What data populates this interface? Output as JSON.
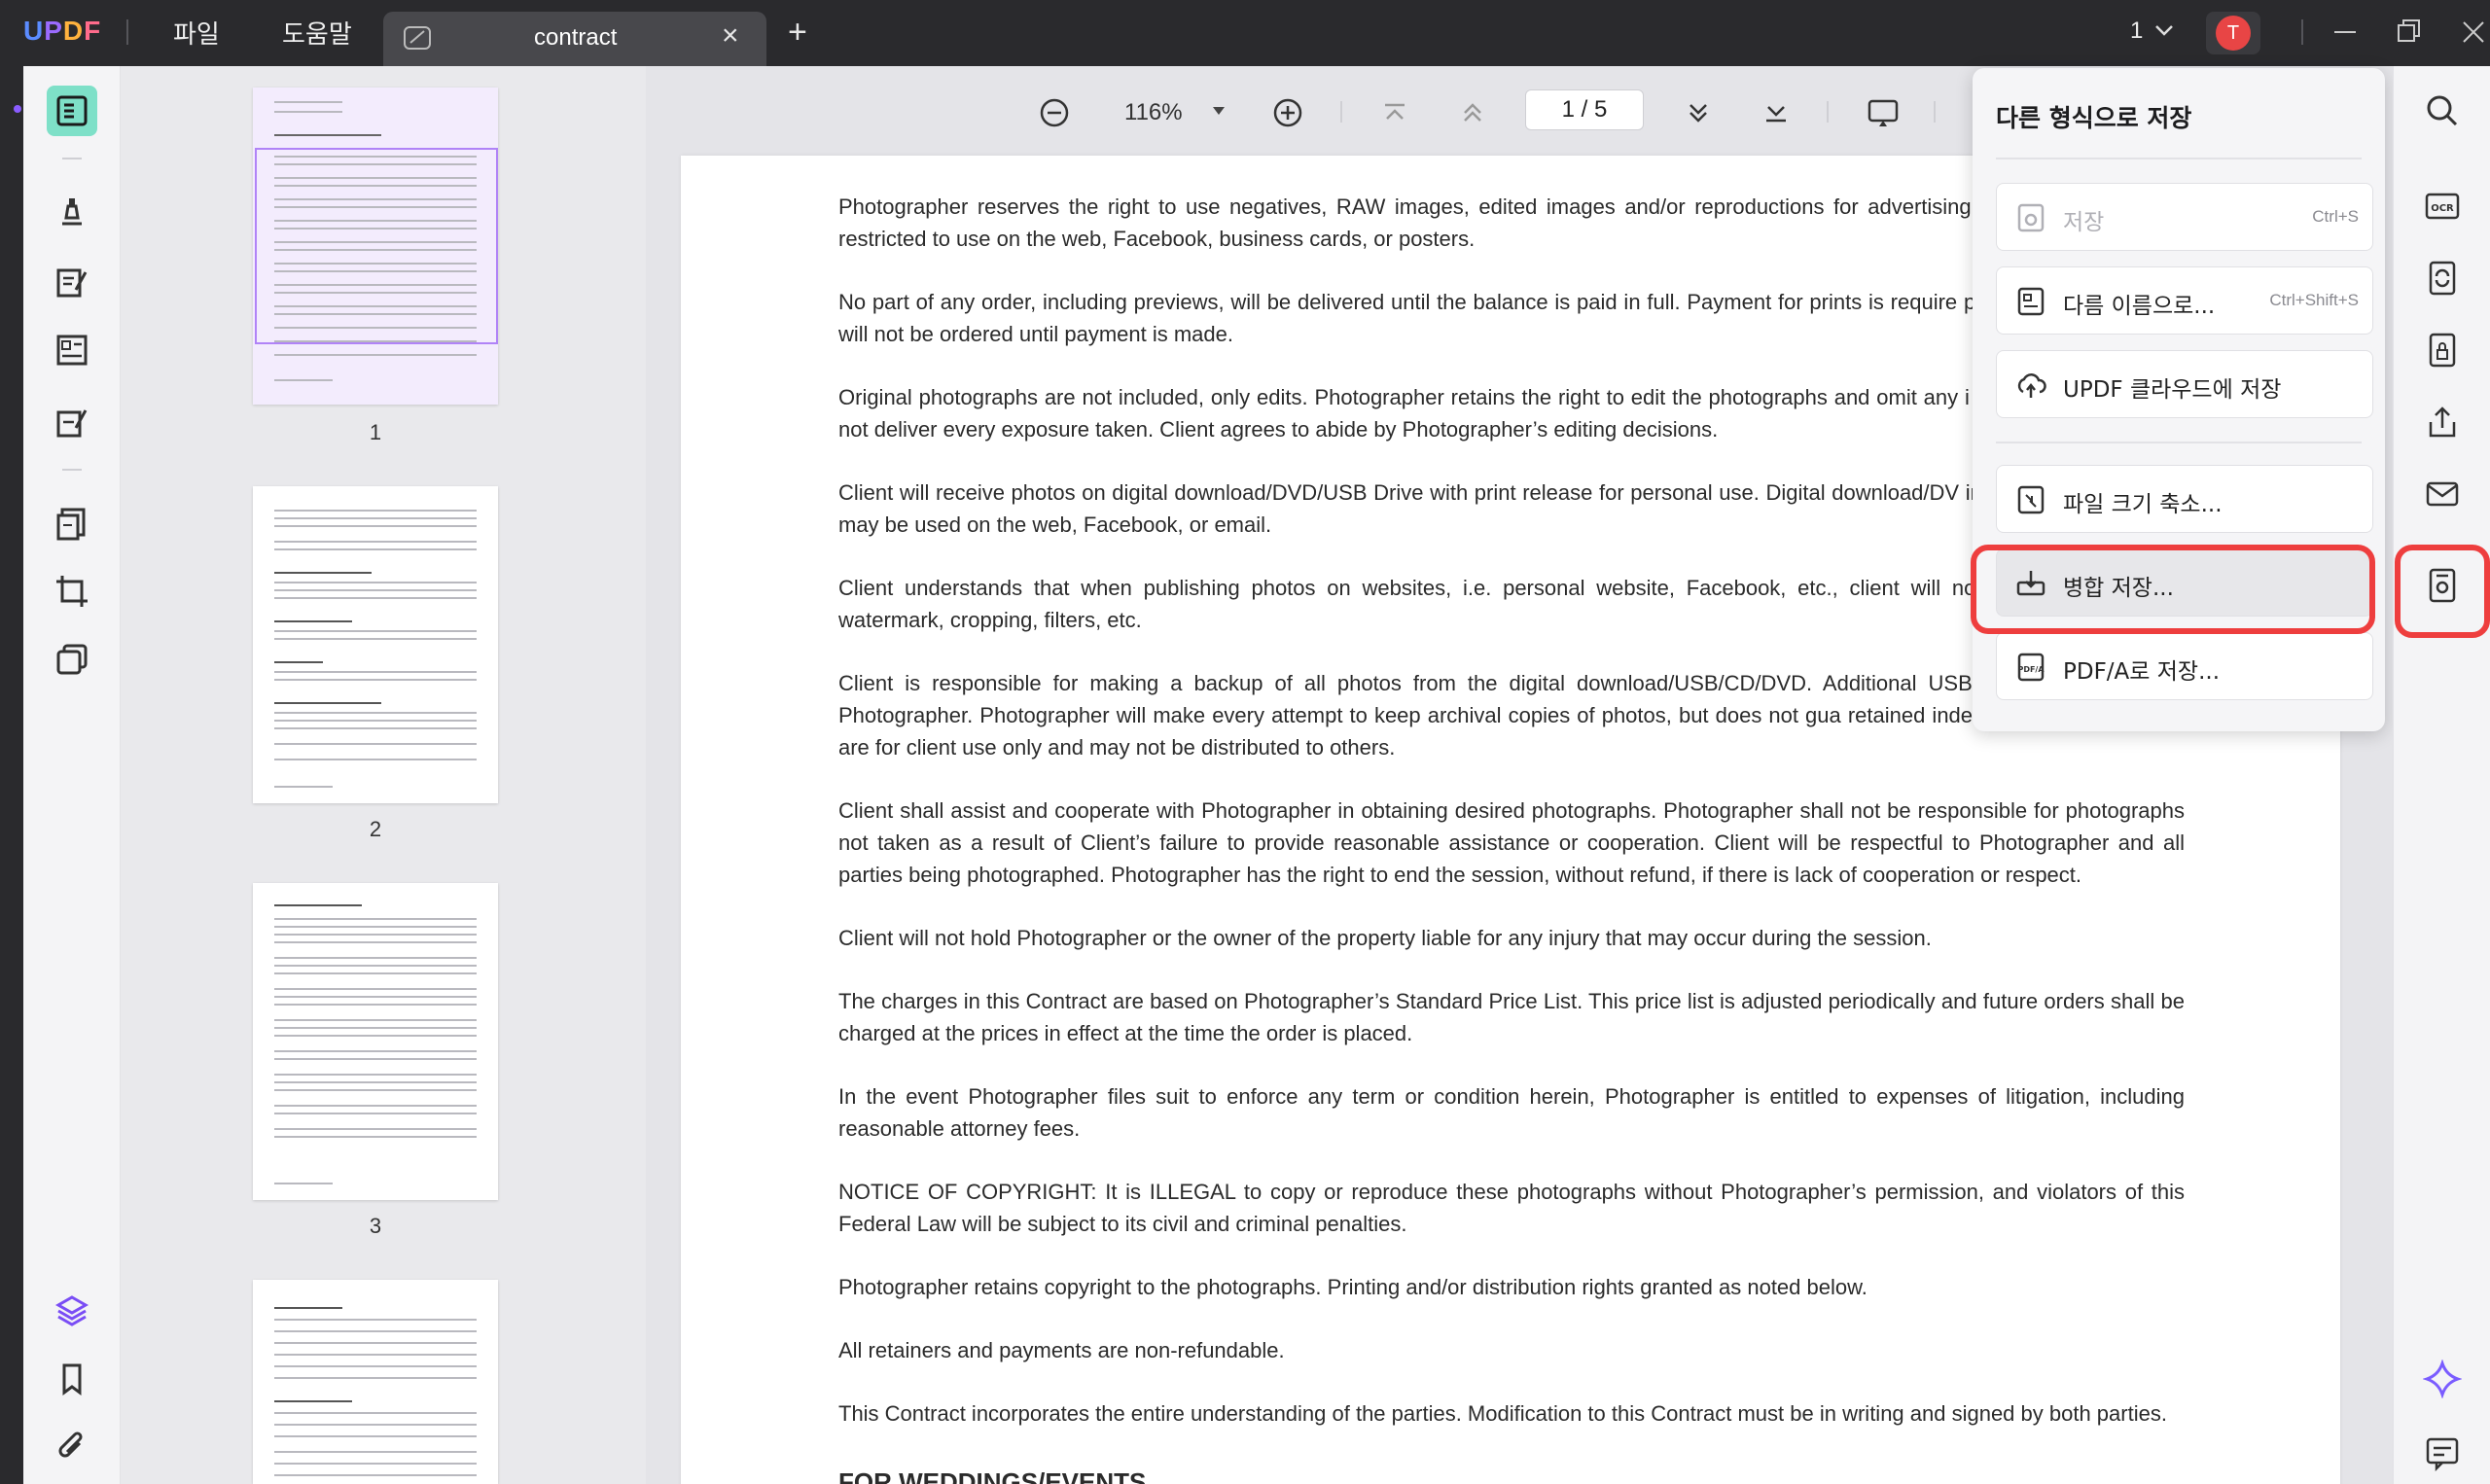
{
  "app": {
    "logo": "UPDF"
  },
  "menu": {
    "file": "파일",
    "help": "도움말"
  },
  "tab": {
    "title": "contract",
    "close": "×",
    "add": "+"
  },
  "window": {
    "count": "1",
    "avatar_letter": "T"
  },
  "thumbnails": [
    {
      "label": "1"
    },
    {
      "label": "2"
    },
    {
      "label": "3"
    }
  ],
  "toolbar": {
    "zoom": "116%",
    "page_current": "1",
    "page_sep": "/",
    "page_total": "5"
  },
  "document": {
    "paragraphs": [
      "Photographer reserves the right to use negatives, RAW images, edited images and/or reproductions for advertising, displa purposes, not restricted to use on the web, Facebook, business cards, or posters.",
      "No part of any order, including previews, will be delivered until the balance is paid in full. Payment for prints is require placing an order. Prints will not be ordered until payment is made.",
      "Original photographs are not included, only edits. Photographer retains the right to edit the photographs and omit any i that Photographer will not deliver every exposure taken. Client agrees to abide by Photographer’s editing decisions.",
      "Client will receive photos on digital download/DVD/USB Drive with print release for personal use. Digital download/DV images for printing and may be used on the web, Facebook, or email.",
      "Client understands that when publishing photos on websites, i.e. personal website, Facebook, etc., client will not edit the editing the watermark, cropping, filters, etc.",
      "Client is responsible for making a backup of all photos from the digital download/USB/CD/DVD. Additional USB driv purchased from Photographer. Photographer will make every attempt to keep archival copies of photos, but does not gua retained indefinitely. Backup copies are for client use only and may not be distributed to others.",
      "Client shall assist and cooperate with Photographer in obtaining desired photographs. Photographer shall not be responsible for photographs not taken as a result of Client’s failure to provide reasonable assistance or cooperation. Client will be respectful to Photographer and all parties being photographed. Photographer has the right to end the session, without refund, if there is lack of cooperation or respect.",
      "Client will not hold Photographer or the owner of the property liable for any injury that may occur during the session.",
      "The charges in this Contract are based on Photographer’s Standard Price List. This price list is adjusted periodically and future orders shall be charged at the prices in effect at the time the order is placed.",
      "In the event Photographer files suit to enforce any term or condition herein, Photographer is entitled to expenses of litigation, including reasonable attorney fees.",
      "NOTICE OF COPYRIGHT: It is ILLEGAL to copy or reproduce these photographs without Photographer’s permission, and violators of this Federal Law will be subject to its civil and criminal penalties.",
      "Photographer retains copyright to the photographs. Printing and/or distribution rights granted as noted below.",
      "All retainers and payments are non-refundable.",
      "This Contract incorporates the entire understanding of the parties. Modification to this Contract must be in writing and signed by both parties."
    ],
    "heading_partial": "FOR WEDDINGS/EVENTS"
  },
  "save_menu": {
    "title": "다른 형식으로 저장",
    "items": [
      {
        "label": "저장",
        "shortcut": "Ctrl+S",
        "disabled": true
      },
      {
        "label": "다름 이름으로...",
        "shortcut": "Ctrl+Shift+S"
      },
      {
        "label": "UPDF 클라우드에 저장"
      },
      {
        "label": "파일 크기 축소..."
      },
      {
        "label": "병합 저장...",
        "highlighted": true
      },
      {
        "label": "PDF/A로 저장..."
      }
    ]
  },
  "colors": {
    "titlebar": "#2a2a2d",
    "accent_active": "#7ee0c8",
    "highlight_red": "#ee3e3e",
    "thumb_selected": "#b083f7"
  }
}
